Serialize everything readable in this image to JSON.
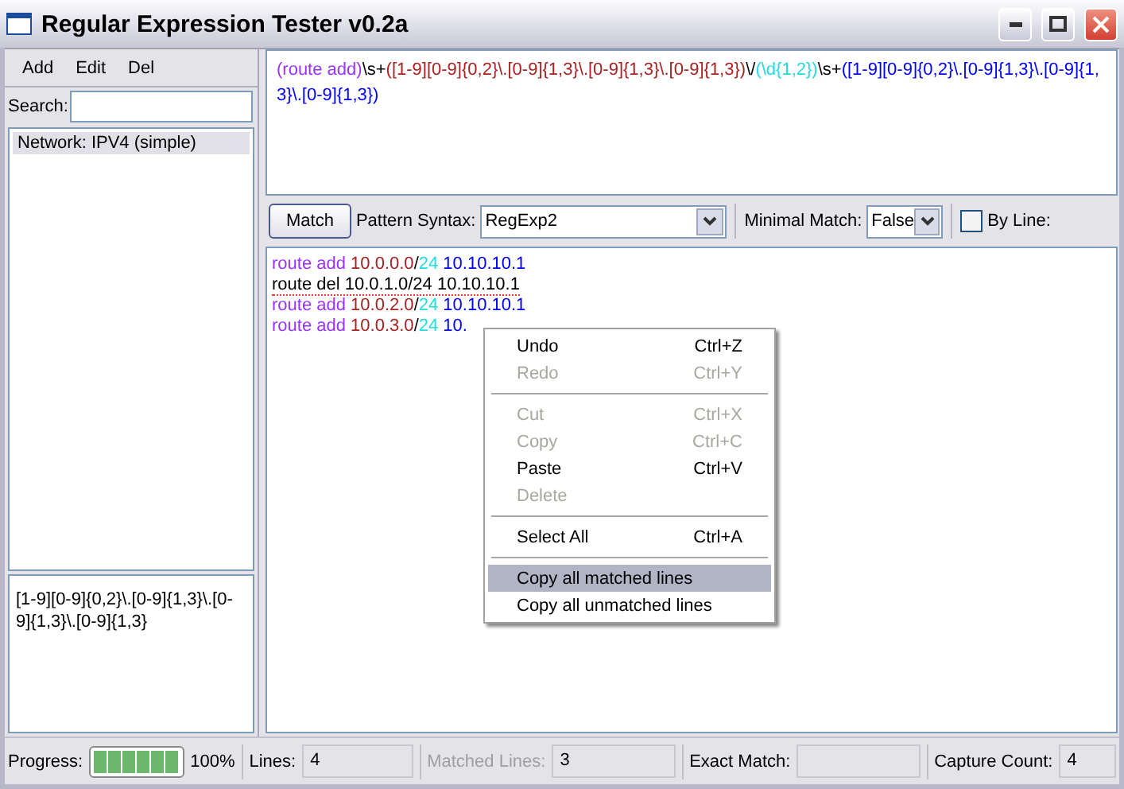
{
  "window": {
    "title": "Regular Expression Tester v0.2a"
  },
  "menu": [
    "Add",
    "Edit",
    "Del"
  ],
  "search": {
    "label": "Search:"
  },
  "list": [
    {
      "label": "Network: IPV4 (simple)",
      "selected": true
    }
  ],
  "description": "[1-9][0-9]{0,2}\\.[0-9]{1,3}\\.[0-9]{1,3}\\.[0-9]{1,3}",
  "pattern": [
    {
      "text": "(route add)",
      "color": "#9933ff"
    },
    {
      "text": "\\s+",
      "color": "#000000"
    },
    {
      "text": "([1-9][0-9]{0,2}\\.[0-9]{1,3}\\.[0-9]{1,3}\\.[0-9]{1,3})",
      "color": "#aa2222"
    },
    {
      "text": "\\/",
      "color": "#000000"
    },
    {
      "text": "(\\d{1,2})",
      "color": "#22dddd"
    },
    {
      "text": "\\s+",
      "color": "#000000"
    },
    {
      "text": "([1-9][0-9]{0,2}\\.[0-9]{1,3}\\.[0-9]{1,3}\\.[0-9]{1,3})",
      "color": "#0000ff"
    }
  ],
  "toolbar": {
    "match_button": "Match",
    "syntax_label": "Pattern Syntax:",
    "syntax_value": "RegExp2",
    "minimal_label": "Minimal Match:",
    "minimal_value": "False",
    "by_line": {
      "label": "By Line:",
      "checked": false
    }
  },
  "results": [
    {
      "matched": true,
      "segments": [
        {
          "text": "route add ",
          "color": "#9933ff"
        },
        {
          "text": "10.0.0.0",
          "color": "#aa2222"
        },
        {
          "text": "/",
          "color": "#000000"
        },
        {
          "text": "24",
          "color": "#22dddd"
        },
        {
          "text": " 10.10.10.1",
          "color": "#0000ff"
        }
      ]
    },
    {
      "matched": false,
      "segments": [
        {
          "text": "route del 10.0.1.0/24 10.10.10.1",
          "color": "#000000"
        }
      ]
    },
    {
      "matched": true,
      "segments": [
        {
          "text": "route add ",
          "color": "#9933ff"
        },
        {
          "text": "10.0.2.0",
          "color": "#aa2222"
        },
        {
          "text": "/",
          "color": "#000000"
        },
        {
          "text": "24",
          "color": "#22dddd"
        },
        {
          "text": " 10.10.10.1",
          "color": "#0000ff"
        }
      ]
    },
    {
      "matched": true,
      "segments": [
        {
          "text": "route add ",
          "color": "#9933ff"
        },
        {
          "text": "10.0.3.0",
          "color": "#aa2222"
        },
        {
          "text": "/",
          "color": "#000000"
        },
        {
          "text": "24",
          "color": "#22dddd"
        },
        {
          "text": " 10.",
          "color": "#0000ff"
        }
      ]
    }
  ],
  "context_menu": [
    {
      "kind": "item",
      "label": "Undo",
      "shortcut": "Ctrl+Z",
      "disabled": false,
      "selected": false
    },
    {
      "kind": "item",
      "label": "Redo",
      "shortcut": "Ctrl+Y",
      "disabled": true,
      "selected": false
    },
    {
      "kind": "separator"
    },
    {
      "kind": "item",
      "label": "Cut",
      "shortcut": "Ctrl+X",
      "disabled": true,
      "selected": false
    },
    {
      "kind": "item",
      "label": "Copy",
      "shortcut": "Ctrl+C",
      "disabled": true,
      "selected": false
    },
    {
      "kind": "item",
      "label": "Paste",
      "shortcut": "Ctrl+V",
      "disabled": false,
      "selected": false
    },
    {
      "kind": "item",
      "label": "Delete",
      "disabled": true,
      "selected": false
    },
    {
      "kind": "separator"
    },
    {
      "kind": "item",
      "label": "Select All",
      "shortcut": "Ctrl+A",
      "disabled": false,
      "selected": false
    },
    {
      "kind": "separator"
    },
    {
      "kind": "item",
      "label": "Copy all matched lines",
      "disabled": false,
      "selected": true
    },
    {
      "kind": "item",
      "label": "Copy all unmatched lines",
      "disabled": false,
      "selected": false
    }
  ],
  "status_bar": {
    "progress": {
      "label": "Progress:",
      "level": 1,
      "reading": "100%"
    },
    "fields": [
      {
        "label": "Lines:",
        "value": "4",
        "disabled": false
      },
      {
        "label": "Matched Lines:",
        "value": "3",
        "disabled": true
      },
      {
        "label": "Exact Match:",
        "disabled": false
      },
      {
        "label": "Capture Count:",
        "value": "4",
        "disabled": false
      }
    ]
  }
}
